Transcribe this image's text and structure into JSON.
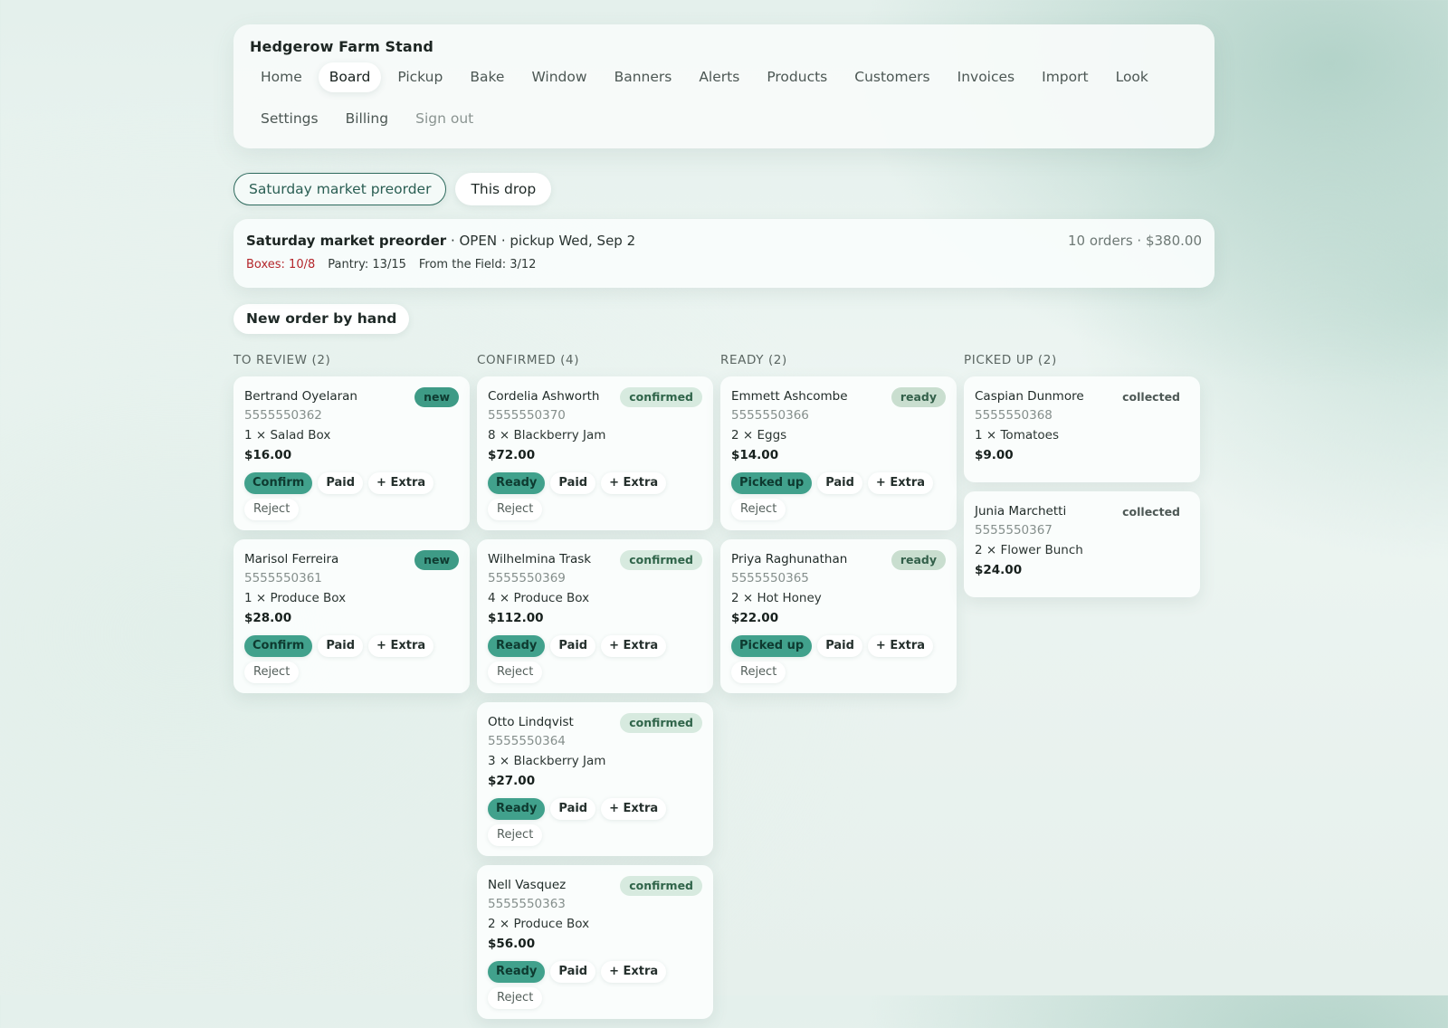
{
  "app": {
    "name": "Hedgerow Farm Stand"
  },
  "nav": [
    {
      "label": "Home",
      "active": false
    },
    {
      "label": "Board",
      "active": true
    },
    {
      "label": "Pickup",
      "active": false
    },
    {
      "label": "Bake",
      "active": false
    },
    {
      "label": "Window",
      "active": false
    },
    {
      "label": "Banners",
      "active": false
    },
    {
      "label": "Alerts",
      "active": false
    },
    {
      "label": "Products",
      "active": false
    },
    {
      "label": "Customers",
      "active": false
    },
    {
      "label": "Invoices",
      "active": false
    },
    {
      "label": "Import",
      "active": false
    },
    {
      "label": "Look",
      "active": false
    },
    {
      "label": "Settings",
      "active": false
    },
    {
      "label": "Billing",
      "active": false
    },
    {
      "label": "Sign out",
      "active": false,
      "muted": true
    }
  ],
  "tabs": [
    {
      "label": "Saturday market preorder",
      "active": true
    },
    {
      "label": "This drop",
      "active": false
    }
  ],
  "summary": {
    "title": "Saturday market preorder",
    "status": "· OPEN · pickup Wed, Sep 2",
    "totals": "10 orders · $380.00",
    "stock": [
      {
        "text": "Boxes: 10/8",
        "warn": true
      },
      {
        "text": "Pantry: 13/15",
        "warn": false
      },
      {
        "text": "From the Field: 3/12",
        "warn": false
      }
    ]
  },
  "new_order_label": "New order by hand",
  "columns": [
    {
      "title": "TO REVIEW (2)",
      "cards": [
        {
          "name": "Bertrand Oyelaran",
          "phone": "5555550362",
          "line": "1 × Salad Box",
          "price": "$16.00",
          "status": "new",
          "primary": "Confirm"
        },
        {
          "name": "Marisol Ferreira",
          "phone": "5555550361",
          "line": "1 × Produce Box",
          "price": "$28.00",
          "status": "new",
          "primary": "Confirm"
        }
      ]
    },
    {
      "title": "CONFIRMED (4)",
      "cards": [
        {
          "name": "Cordelia Ashworth",
          "phone": "5555550370",
          "line": "8 × Blackberry Jam",
          "price": "$72.00",
          "status": "confirmed",
          "primary": "Ready"
        },
        {
          "name": "Wilhelmina Trask",
          "phone": "5555550369",
          "line": "4 × Produce Box",
          "price": "$112.00",
          "status": "confirmed",
          "primary": "Ready"
        },
        {
          "name": "Otto Lindqvist",
          "phone": "5555550364",
          "line": "3 × Blackberry Jam",
          "price": "$27.00",
          "status": "confirmed",
          "primary": "Ready"
        },
        {
          "name": "Nell Vasquez",
          "phone": "5555550363",
          "line": "2 × Produce Box",
          "price": "$56.00",
          "status": "confirmed",
          "primary": "Ready"
        }
      ]
    },
    {
      "title": "READY (2)",
      "cards": [
        {
          "name": "Emmett Ashcombe",
          "phone": "5555550366",
          "line": "2 × Eggs",
          "price": "$14.00",
          "status": "ready",
          "primary": "Picked up"
        },
        {
          "name": "Priya Raghunathan",
          "phone": "5555550365",
          "line": "2 × Hot Honey",
          "price": "$22.00",
          "status": "ready",
          "primary": "Picked up"
        }
      ]
    },
    {
      "title": "PICKED UP (2)",
      "cards": [
        {
          "name": "Caspian Dunmore",
          "phone": "5555550368",
          "line": "1 × Tomatoes",
          "price": "$9.00",
          "status": "collected",
          "primary": null
        },
        {
          "name": "Junia Marchetti",
          "phone": "5555550367",
          "line": "2 × Flower Bunch",
          "price": "$24.00",
          "status": "collected",
          "primary": null
        }
      ]
    }
  ],
  "card_actions": {
    "paid": "Paid",
    "extra": "+ Extra",
    "reject": "Reject"
  },
  "colors": {
    "accent": "#41a18c",
    "warn": "#b4262b",
    "tab_border": "#2f6b5e"
  }
}
